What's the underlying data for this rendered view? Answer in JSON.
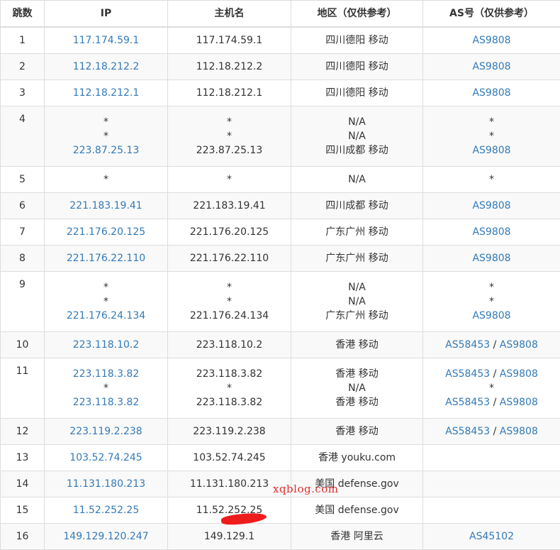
{
  "headers": {
    "hop": "跳数",
    "ip": "IP",
    "hostname": "主机名",
    "region": "地区（仅供参考）",
    "as": "AS号（仅供参考）"
  },
  "rows": [
    {
      "hop": "1",
      "ip": [
        "117.174.59.1"
      ],
      "host": [
        "117.174.59.1"
      ],
      "region": [
        "四川德阳 移动"
      ],
      "as": [
        [
          "AS9808"
        ]
      ]
    },
    {
      "hop": "2",
      "ip": [
        "112.18.212.2"
      ],
      "host": [
        "112.18.212.2"
      ],
      "region": [
        "四川德阳 移动"
      ],
      "as": [
        [
          "AS9808"
        ]
      ]
    },
    {
      "hop": "3",
      "ip": [
        "112.18.212.1"
      ],
      "host": [
        "112.18.212.1"
      ],
      "region": [
        "四川德阳 移动"
      ],
      "as": [
        [
          "AS9808"
        ]
      ]
    },
    {
      "hop": "4",
      "ip": [
        "*",
        "*",
        "223.87.25.13"
      ],
      "host": [
        "*",
        "*",
        "223.87.25.13"
      ],
      "region": [
        "N/A",
        "N/A",
        "四川成都 移动"
      ],
      "as": [
        [
          "*"
        ],
        [
          "*"
        ],
        [
          "AS9808"
        ]
      ]
    },
    {
      "hop": "5",
      "ip": [
        "*"
      ],
      "host": [
        "*"
      ],
      "region": [
        "N/A"
      ],
      "as": [
        [
          "*"
        ]
      ]
    },
    {
      "hop": "6",
      "ip": [
        "221.183.19.41"
      ],
      "host": [
        "221.183.19.41"
      ],
      "region": [
        "四川成都 移动"
      ],
      "as": [
        [
          "AS9808"
        ]
      ]
    },
    {
      "hop": "7",
      "ip": [
        "221.176.20.125"
      ],
      "host": [
        "221.176.20.125"
      ],
      "region": [
        "广东广州 移动"
      ],
      "as": [
        [
          "AS9808"
        ]
      ]
    },
    {
      "hop": "8",
      "ip": [
        "221.176.22.110"
      ],
      "host": [
        "221.176.22.110"
      ],
      "region": [
        "广东广州 移动"
      ],
      "as": [
        [
          "AS9808"
        ]
      ]
    },
    {
      "hop": "9",
      "ip": [
        "*",
        "*",
        "221.176.24.134"
      ],
      "host": [
        "*",
        "*",
        "221.176.24.134"
      ],
      "region": [
        "N/A",
        "N/A",
        "广东广州 移动"
      ],
      "as": [
        [
          "*"
        ],
        [
          "*"
        ],
        [
          "AS9808"
        ]
      ]
    },
    {
      "hop": "10",
      "ip": [
        "223.118.10.2"
      ],
      "host": [
        "223.118.10.2"
      ],
      "region": [
        "香港 移动"
      ],
      "as": [
        [
          "AS58453",
          "AS9808"
        ]
      ]
    },
    {
      "hop": "11",
      "ip": [
        "223.118.3.82",
        "*",
        "223.118.3.82"
      ],
      "host": [
        "223.118.3.82",
        "*",
        "223.118.3.82"
      ],
      "region": [
        "香港 移动",
        "N/A",
        "香港 移动"
      ],
      "as": [
        [
          "AS58453",
          "AS9808"
        ],
        [
          "*"
        ],
        [
          "AS58453",
          "AS9808"
        ]
      ]
    },
    {
      "hop": "12",
      "ip": [
        "223.119.2.238"
      ],
      "host": [
        "223.119.2.238"
      ],
      "region": [
        "香港 移动"
      ],
      "as": [
        [
          "AS58453",
          "AS9808"
        ]
      ]
    },
    {
      "hop": "13",
      "ip": [
        "103.52.74.245"
      ],
      "host": [
        "103.52.74.245"
      ],
      "region": [
        "香港 youku.com"
      ],
      "as": []
    },
    {
      "hop": "14",
      "ip": [
        "11.131.180.213"
      ],
      "host": [
        "11.131.180.213"
      ],
      "region": [
        "美国 defense.gov"
      ],
      "as": []
    },
    {
      "hop": "15",
      "ip": [
        "11.52.252.25"
      ],
      "host": [
        "11.52.252.25"
      ],
      "region": [
        "美国 defense.gov"
      ],
      "as": []
    },
    {
      "hop": "16",
      "ip": [
        "149.129.120.247"
      ],
      "host": [
        "149.129.1"
      ],
      "region": [
        "香港 阿里云"
      ],
      "as": [
        [
          "AS45102"
        ]
      ]
    }
  ],
  "as_separator": " / ",
  "watermark": "xqblog.com",
  "colors": {
    "link": "#337ab7",
    "text": "#333333",
    "border": "#dddddd",
    "stripe": "#f9f9f9",
    "watermark": "#e03030"
  }
}
